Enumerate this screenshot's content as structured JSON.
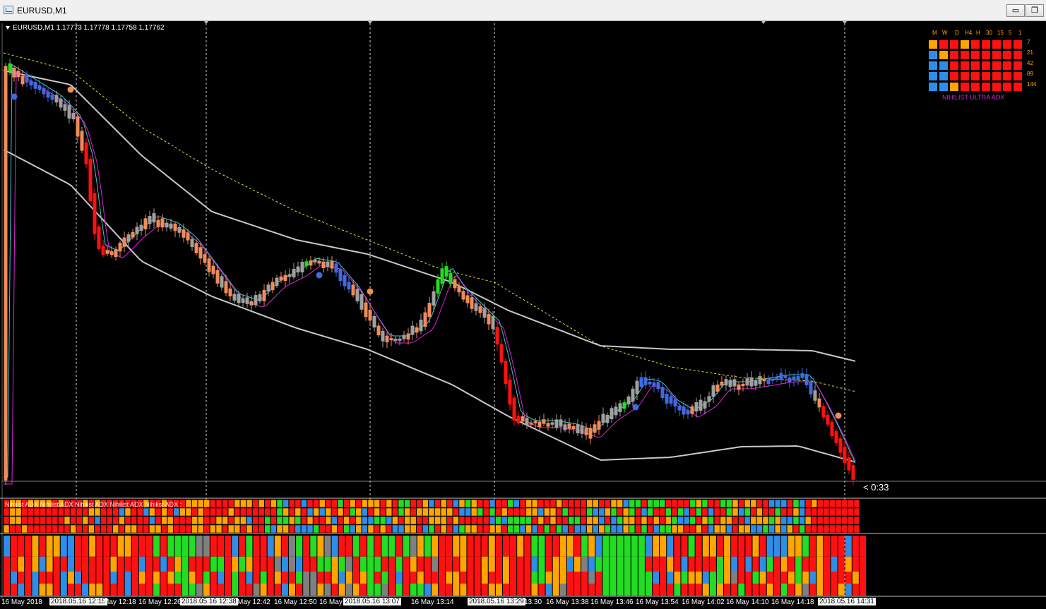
{
  "window": {
    "title": "EURUSD,M1",
    "min_glyph": "▭",
    "max_glyph": "❐"
  },
  "symbol_info": "EURUSD,M1  1.17773 1.17778 1.17758 1.17762",
  "countdown": "< 0:33",
  "colors": {
    "background": "#000000",
    "bull_green": "#22dd22",
    "bear_red": "#ff1111",
    "salmon": "#f08c5a",
    "blue": "#4169e1",
    "gray": "#a0a0a0",
    "orange": "#ffa500",
    "magenta": "#e020e0",
    "cyan": "#40c8c8",
    "yellow_dash": "#e6e632"
  },
  "mtf_panel": {
    "timeframes": [
      "M",
      "W",
      "D",
      "H4",
      "H",
      "30",
      "15",
      "5",
      "1"
    ],
    "periods": [
      "7",
      "21",
      "42",
      "89",
      "144"
    ],
    "grid": [
      [
        "orange",
        "red",
        "red",
        "orange",
        "red",
        "red",
        "red",
        "red",
        "red"
      ],
      [
        "blue",
        "orange",
        "red",
        "red",
        "red",
        "red",
        "red",
        "red",
        "red"
      ],
      [
        "blue",
        "blue",
        "red",
        "red",
        "red",
        "red",
        "red",
        "red",
        "red"
      ],
      [
        "blue",
        "blue",
        "red",
        "red",
        "red",
        "red",
        "red",
        "red",
        "red"
      ],
      [
        "blue",
        "blue",
        "orange",
        "red",
        "red",
        "red",
        "red",
        "red",
        "red"
      ]
    ],
    "name": "NIHILIST ULTRA ADX"
  },
  "time_axis": [
    {
      "text": "16 May 2018",
      "hl": false
    },
    {
      "text": "2018.05.16 12:15",
      "hl": true
    },
    {
      "text": "May 12:18",
      "hl": false
    },
    {
      "text": "16 May 12:26",
      "hl": false
    },
    {
      "text": "2018.05.16 12:38",
      "hl": true
    },
    {
      "text": "May 12:42",
      "hl": false
    },
    {
      "text": "16 May 12:50",
      "hl": false
    },
    {
      "text": "16 May 12:58",
      "hl": false
    },
    {
      "text": "2018.05.16 13:07",
      "hl": true
    },
    {
      "text": "16 May 13:14",
      "hl": false
    },
    {
      "text": "2018.05.16 13:29",
      "hl": true
    },
    {
      "text": "13:30",
      "hl": false
    },
    {
      "text": "16 May 13:38",
      "hl": false
    },
    {
      "text": "16 May 13:46",
      "hl": false
    },
    {
      "text": "16 May 13:54",
      "hl": false
    },
    {
      "text": "16 May 14:02",
      "hl": false
    },
    {
      "text": "16 May 14:10",
      "hl": false
    },
    {
      "text": "16 May 14:18",
      "hl": false
    },
    {
      "text": "2018.05.16 14:31",
      "hl": true
    }
  ],
  "subwindow_label": "Nihilist ADX Nihilist ADX Nihilist ADX Nihilist ADX Nihilist ADX :"
}
